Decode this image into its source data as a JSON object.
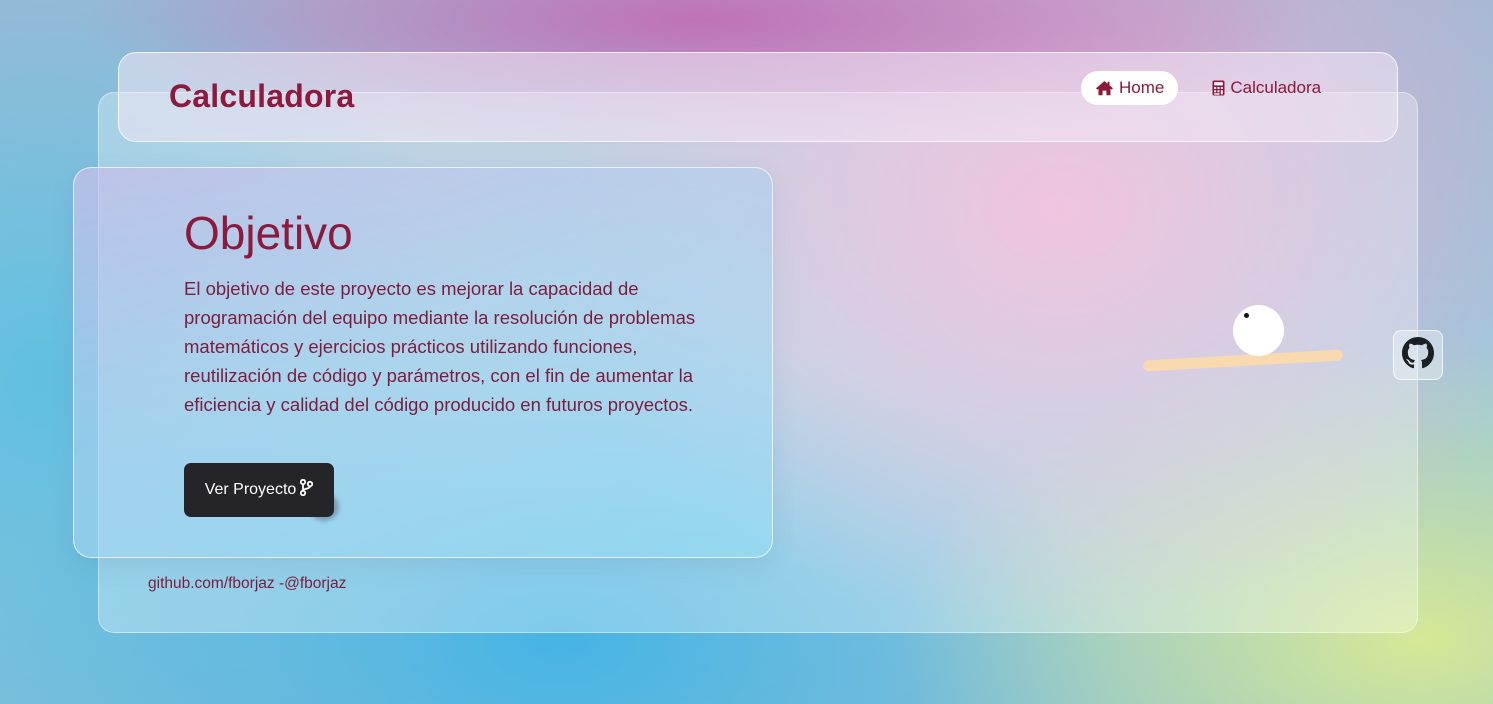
{
  "navbar": {
    "brand": "Calculadora",
    "links": [
      {
        "label": "Home",
        "icon": "home-icon",
        "active": true
      },
      {
        "label": "Calculadora",
        "icon": "calculator-icon",
        "active": false
      }
    ]
  },
  "card": {
    "title": "Objetivo",
    "text": "El objetivo de este proyecto es mejorar la capacidad de programación del equipo mediante la resolución de problemas matemáticos y ejercicios prácticos utilizando funciones, reutilización de código y parámetros, con el fin de aumentar la eficiencia y calidad del código producido en futuros proyectos.",
    "button_label": "Ver Proyecto",
    "button_icon": "code-branch-icon"
  },
  "footer": {
    "text": "github.com/fborjaz -@fborjaz"
  },
  "github": {
    "icon": "github-icon"
  },
  "colors": {
    "accent": "#8b1a3c",
    "button_bg": "#252428",
    "nav_active_bg": "#ffffff"
  }
}
